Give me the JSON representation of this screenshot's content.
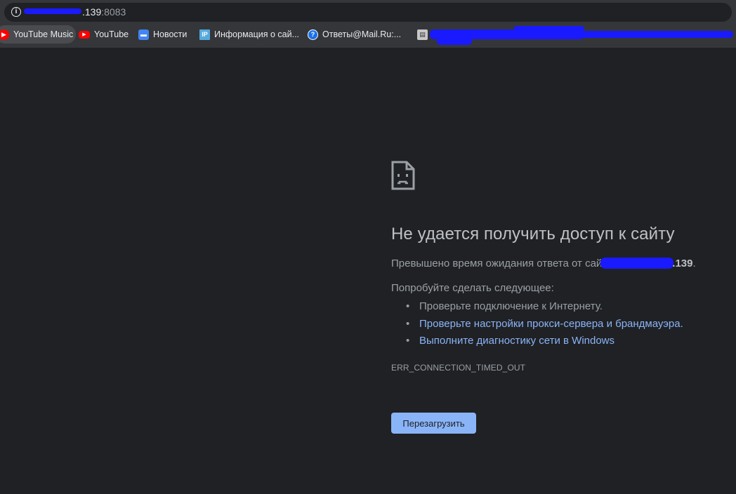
{
  "browser": {
    "url_host_suffix": ".139",
    "url_port": ":8083",
    "bookmarks": [
      {
        "label": "YouTube Music",
        "icon": "youtube-music-icon"
      },
      {
        "label": "YouTube",
        "icon": "youtube-icon"
      },
      {
        "label": "Новости",
        "icon": "news-icon"
      },
      {
        "label": "Информация о сай...",
        "icon": "ip-info-icon"
      },
      {
        "label": "Ответы@Mail.Ru:...",
        "icon": "mail-answers-icon"
      },
      {
        "label": "",
        "icon": "generic-page-icon"
      }
    ]
  },
  "error_page": {
    "title": "Не удается получить доступ к сайту",
    "desc_prefix": "Превышено время ожидания ответа от сай",
    "desc_host_suffix": ".139",
    "desc_end": ".",
    "try_heading": "Попробуйте сделать следующее:",
    "suggestions": [
      "Проверьте подключение к Интернету.",
      "Проверьте настройки прокси-сервера и брандмауэра.",
      "Выполните диагностику сети в Windows"
    ],
    "error_code": "ERR_CONNECTION_TIMED_OUT",
    "reload_label": "Перезагрузить"
  },
  "colors": {
    "background": "#202124",
    "toolbar": "#35363a",
    "link": "#8ab4f8",
    "button": "#8ab4f8",
    "redaction": "#1a1aff"
  }
}
